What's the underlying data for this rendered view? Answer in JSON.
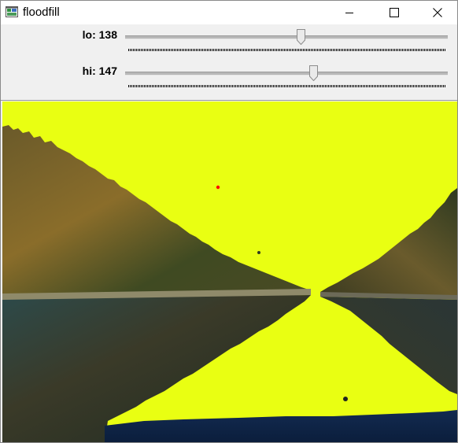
{
  "window": {
    "title": "floodfill",
    "icon": "opencv-window-icon",
    "controls": [
      "minimize-icon",
      "maximize-icon",
      "close-icon"
    ]
  },
  "trackbars": [
    {
      "label": "lo: 138",
      "name": "lo",
      "value": 138,
      "max": 255
    },
    {
      "label": "hi: 147",
      "name": "hi",
      "value": 147,
      "max": 255
    }
  ],
  "image": {
    "description_free": true,
    "fill_color": "#e9ff12",
    "seed_point_color": "#ff0000"
  },
  "colors": {
    "fill": "#e9ff12",
    "seed": "#ff0000",
    "panel": "#f0f0f0"
  }
}
